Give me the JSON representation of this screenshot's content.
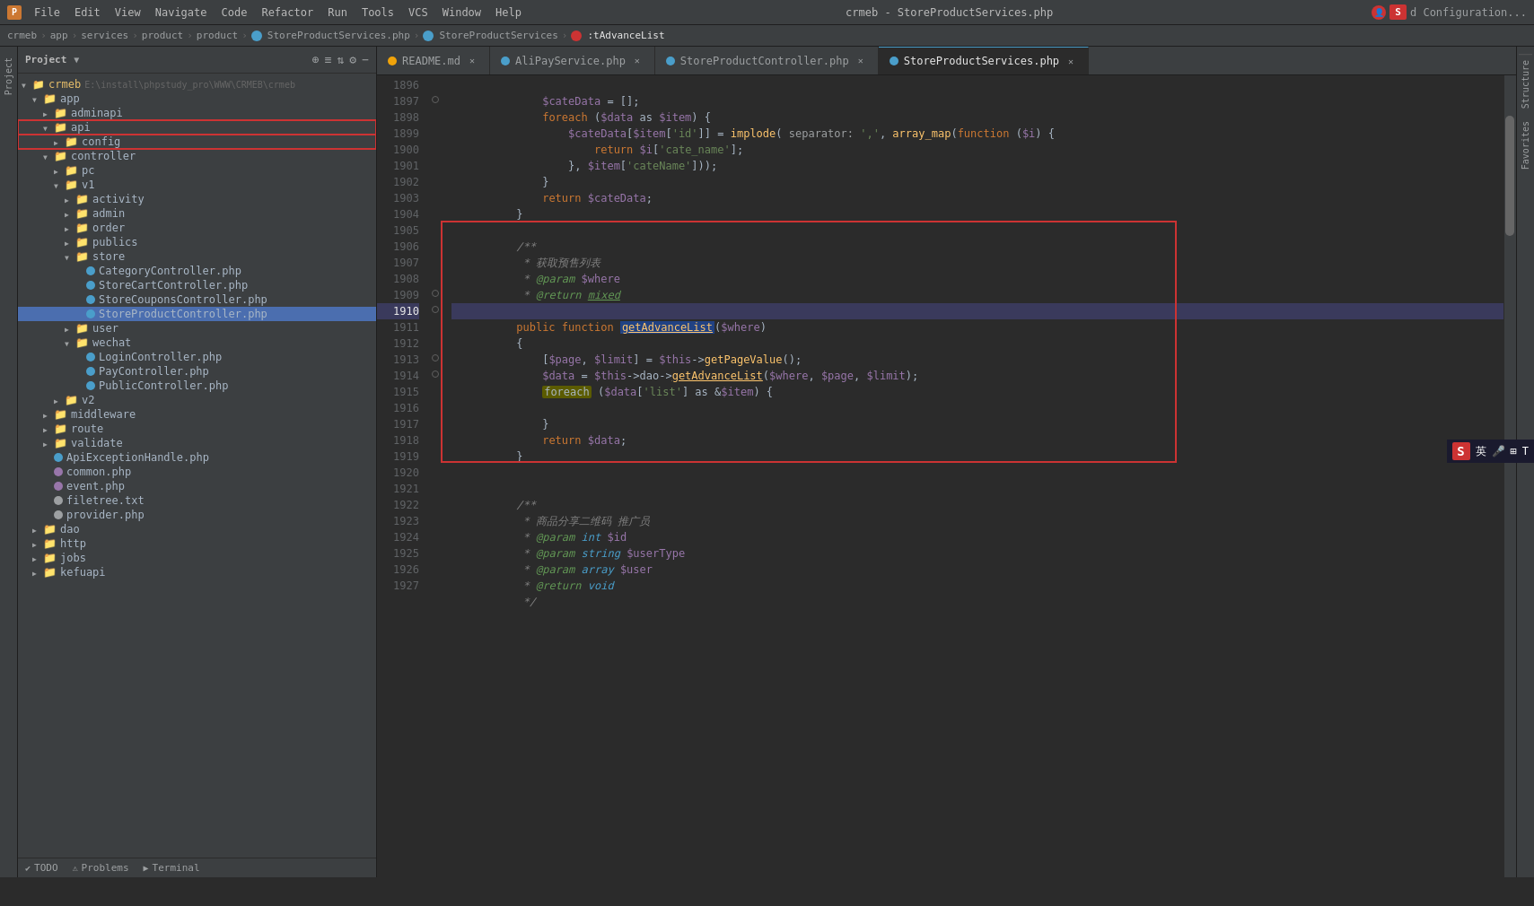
{
  "app": {
    "title": "crmeb - StoreProductServices.php",
    "icon_label": "P"
  },
  "menu": {
    "items": [
      "File",
      "Edit",
      "View",
      "Navigate",
      "Code",
      "Refactor",
      "Run",
      "Tools",
      "VCS",
      "Window",
      "Help"
    ]
  },
  "breadcrumb": {
    "items": [
      "crmeb",
      "app",
      "services",
      "product",
      "product",
      "StoreProductServices.php",
      "StoreProductServices",
      ":tAdvanceList"
    ]
  },
  "tabs": [
    {
      "label": "README.md",
      "icon": "orange",
      "active": false
    },
    {
      "label": "AliPayService.php",
      "icon": "blue",
      "active": false
    },
    {
      "label": "StoreProductController.php",
      "icon": "blue",
      "active": false
    },
    {
      "label": "StoreProductServices.php",
      "icon": "blue",
      "active": true
    }
  ],
  "file_tree": {
    "title": "Project",
    "root": "crmeb",
    "root_path": "E:\\install\\phpstudy_pro\\WWW\\CRMEB\\crmeb",
    "items": [
      {
        "label": "app",
        "type": "folder",
        "level": 1,
        "expanded": true
      },
      {
        "label": "adminapi",
        "type": "folder",
        "level": 2,
        "expanded": false
      },
      {
        "label": "api",
        "type": "folder",
        "level": 2,
        "expanded": true,
        "red_box": true
      },
      {
        "label": "config",
        "type": "folder",
        "level": 3,
        "expanded": false,
        "red_box": true
      },
      {
        "label": "controller",
        "type": "folder",
        "level": 2,
        "expanded": true
      },
      {
        "label": "pc",
        "type": "folder",
        "level": 3,
        "expanded": false
      },
      {
        "label": "v1",
        "type": "folder",
        "level": 3,
        "expanded": true
      },
      {
        "label": "activity",
        "type": "folder",
        "level": 4,
        "expanded": false
      },
      {
        "label": "admin",
        "type": "folder",
        "level": 4,
        "expanded": false
      },
      {
        "label": "order",
        "type": "folder",
        "level": 4,
        "expanded": false
      },
      {
        "label": "publics",
        "type": "folder",
        "level": 4,
        "expanded": false
      },
      {
        "label": "store",
        "type": "folder",
        "level": 4,
        "expanded": true
      },
      {
        "label": "CategoryController.php",
        "type": "file",
        "level": 5,
        "icon": "blue"
      },
      {
        "label": "StoreCartController.php",
        "type": "file",
        "level": 5,
        "icon": "blue"
      },
      {
        "label": "StoreCouponsController.php",
        "type": "file",
        "level": 5,
        "icon": "blue"
      },
      {
        "label": "StoreProductController.php",
        "type": "file",
        "level": 5,
        "icon": "blue",
        "selected": true
      },
      {
        "label": "user",
        "type": "folder",
        "level": 4,
        "expanded": false
      },
      {
        "label": "wechat",
        "type": "folder",
        "level": 4,
        "expanded": true
      },
      {
        "label": "LoginController.php",
        "type": "file",
        "level": 5,
        "icon": "blue"
      },
      {
        "label": "PayController.php",
        "type": "file",
        "level": 5,
        "icon": "blue"
      },
      {
        "label": "PublicController.php",
        "type": "file",
        "level": 5,
        "icon": "blue"
      },
      {
        "label": "v2",
        "type": "folder",
        "level": 3,
        "expanded": false
      },
      {
        "label": "middleware",
        "type": "folder",
        "level": 2,
        "expanded": false
      },
      {
        "label": "route",
        "type": "folder",
        "level": 2,
        "expanded": false
      },
      {
        "label": "validate",
        "type": "folder",
        "level": 2,
        "expanded": false
      },
      {
        "label": "ApiExceptionHandle.php",
        "type": "file",
        "level": 2,
        "icon": "blue"
      },
      {
        "label": "common.php",
        "type": "file",
        "level": 2,
        "icon": "purple"
      },
      {
        "label": "event.php",
        "type": "file",
        "level": 2,
        "icon": "purple"
      },
      {
        "label": "filetree.txt",
        "type": "file",
        "level": 2,
        "icon": "gray"
      },
      {
        "label": "provider.php",
        "type": "file",
        "level": 2,
        "icon": "gray"
      },
      {
        "label": "dao",
        "type": "folder",
        "level": 1,
        "expanded": false
      },
      {
        "label": "http",
        "type": "folder",
        "level": 1,
        "expanded": false
      },
      {
        "label": "jobs",
        "type": "folder",
        "level": 1,
        "expanded": false
      },
      {
        "label": "kefuapi",
        "type": "folder",
        "level": 1,
        "expanded": false
      }
    ]
  },
  "code": {
    "lines": [
      {
        "num": 1896,
        "content": "    $cateData = [];"
      },
      {
        "num": 1897,
        "content": "    foreach ($data as $item) {"
      },
      {
        "num": 1898,
        "content": "        $cateData[$item['id']] = implode( separator: ',', array_map(function ($i) {"
      },
      {
        "num": 1899,
        "content": "            return $i['cate_name'];"
      },
      {
        "num": 1900,
        "content": "        }, $item['cateName']));"
      },
      {
        "num": 1901,
        "content": "    }"
      },
      {
        "num": 1902,
        "content": "    return $cateData;"
      },
      {
        "num": 1903,
        "content": "}"
      },
      {
        "num": 1904,
        "content": ""
      },
      {
        "num": 1905,
        "content": "/**"
      },
      {
        "num": 1906,
        "content": " * 获取预售列表"
      },
      {
        "num": 1907,
        "content": " * @param $where"
      },
      {
        "num": 1908,
        "content": " * @return mixed"
      },
      {
        "num": 1909,
        "content": " */"
      },
      {
        "num": 1910,
        "content": "public function getAdvanceList($where)"
      },
      {
        "num": 1911,
        "content": "{"
      },
      {
        "num": 1912,
        "content": "    [$page, $limit] = $this->getPageValue();"
      },
      {
        "num": 1913,
        "content": "    $data = $this->dao->getAdvanceList($where, $page, $limit);"
      },
      {
        "num": 1914,
        "content": "    foreach ($data['list'] as &$item) {"
      },
      {
        "num": 1915,
        "content": ""
      },
      {
        "num": 1916,
        "content": "    }"
      },
      {
        "num": 1917,
        "content": "    return $data;"
      },
      {
        "num": 1918,
        "content": "}"
      },
      {
        "num": 1919,
        "content": ""
      },
      {
        "num": 1920,
        "content": ""
      },
      {
        "num": 1921,
        "content": "/**"
      },
      {
        "num": 1922,
        "content": " * 商品分享二维码 推广员"
      },
      {
        "num": 1923,
        "content": " * @param int $id"
      },
      {
        "num": 1924,
        "content": " * @param string $userType"
      },
      {
        "num": 1925,
        "content": " * @param array $user"
      },
      {
        "num": 1926,
        "content": " * @return void"
      },
      {
        "num": 1927,
        "content": " */"
      }
    ]
  },
  "status_bar": {
    "todo": "TODO",
    "problems": "Problems",
    "terminal": "Terminal"
  },
  "right_sidebar": {
    "structure_label": "Structure",
    "favorites_label": "Favorites"
  },
  "left_sidebar": {
    "project_label": "Project"
  },
  "ime": {
    "logo": "S",
    "text": "英",
    "mic": "🎤",
    "grid": "⊞",
    "expand": "T"
  },
  "config_label": "d Configuration..."
}
